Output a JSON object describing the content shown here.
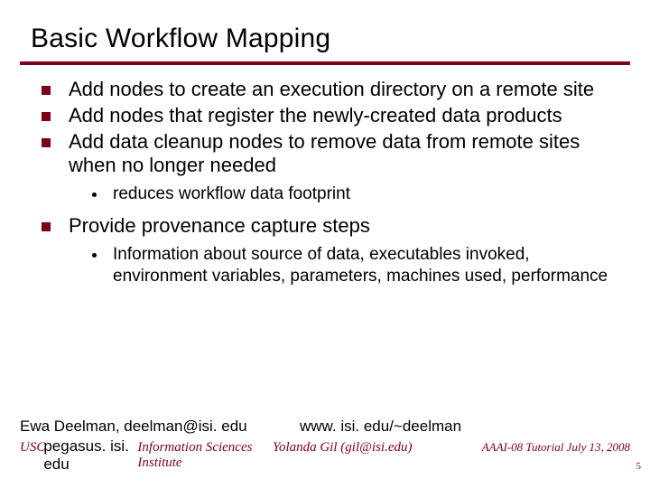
{
  "title": "Basic Workflow Mapping",
  "bullets": [
    {
      "text": "Add nodes to create an execution directory on a remote site"
    },
    {
      "text": "Add nodes that register the newly-created data products"
    },
    {
      "text": "Add data cleanup nodes to remove data from remote sites when no longer needed",
      "sub": [
        "reduces workflow data footprint"
      ]
    },
    {
      "text": "Provide provenance capture steps",
      "sub": [
        "Information about source of data, executables invoked, environment variables, parameters, machines used, performance"
      ]
    }
  ],
  "footer": {
    "author_left": "Ewa Deelman, deelman@isi. edu",
    "url_right": "www. isi. edu/~deelman",
    "usc_prefix": "USC",
    "overlay_text": "pegasus. isi. edu",
    "institute_suffix": "Information Sciences Institute",
    "presenter_mid": "Yolanda Gil (gil@isi.edu)",
    "event_right": "AAAI-08 Tutorial July 13, 2008",
    "page": "5"
  }
}
